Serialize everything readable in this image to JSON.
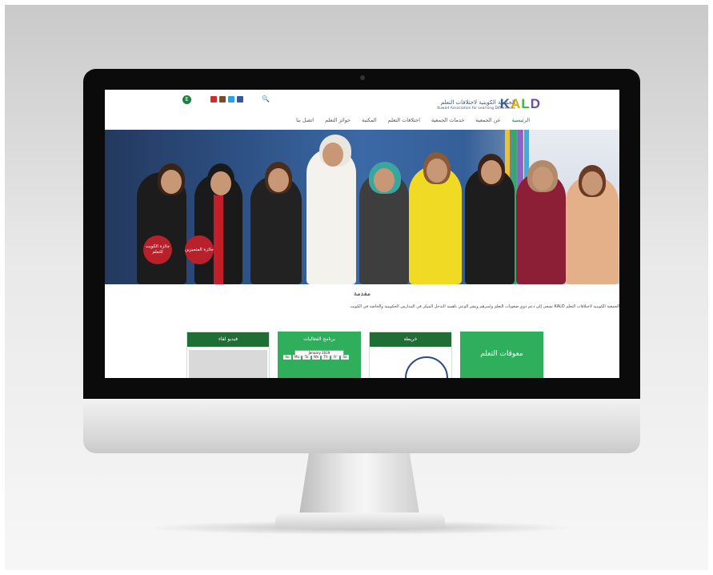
{
  "site": {
    "logo": {
      "letters": [
        "K",
        "A",
        "L",
        "D"
      ],
      "name_ar": "الجمعية الكويتية لاختلافات التعلم",
      "name_en": "Kuwait Association for Learning Differences"
    },
    "lang_button": "E",
    "social_icons": [
      "youtube-icon",
      "instagram-icon",
      "twitter-icon",
      "facebook-icon"
    ],
    "nav": [
      "الرئيسية",
      "عن الجمعية",
      "خدمات الجمعية",
      "اختلافات التعلم",
      "المكتبة",
      "جوائز التعلم",
      "اتصل بنا"
    ],
    "hero_badges": [
      "جائزة الكويت للتعلم",
      "جائزة المتميزين"
    ],
    "intro_title": "مقدمة",
    "intro_text": "الجمعية الكويتية لاختلافات التعلم KALD تسعى إلى دعم ذوي صعوبات التعلم وأسرهم ونشر الوعي بأهمية التدخل المبكر في المدارس الحكومية والخاصة في الكويت",
    "cards": [
      {
        "title": "معوقات التعلم",
        "color": "#2fae5b"
      },
      {
        "title": "خريطة",
        "color": "#1e6e36"
      },
      {
        "title": "برنامج الفعاليات",
        "color": "#2fae5b",
        "month": "January 2019"
      },
      {
        "title": "فيديو لقاء",
        "color": "#1e6e36"
      }
    ],
    "calendar_days": [
      "Su",
      "Mo",
      "Tu",
      "We",
      "Th",
      "Fr",
      "Sa"
    ]
  },
  "colors": {
    "accent": "#1e7e3e",
    "brand_blue": "#3d5a8a"
  }
}
